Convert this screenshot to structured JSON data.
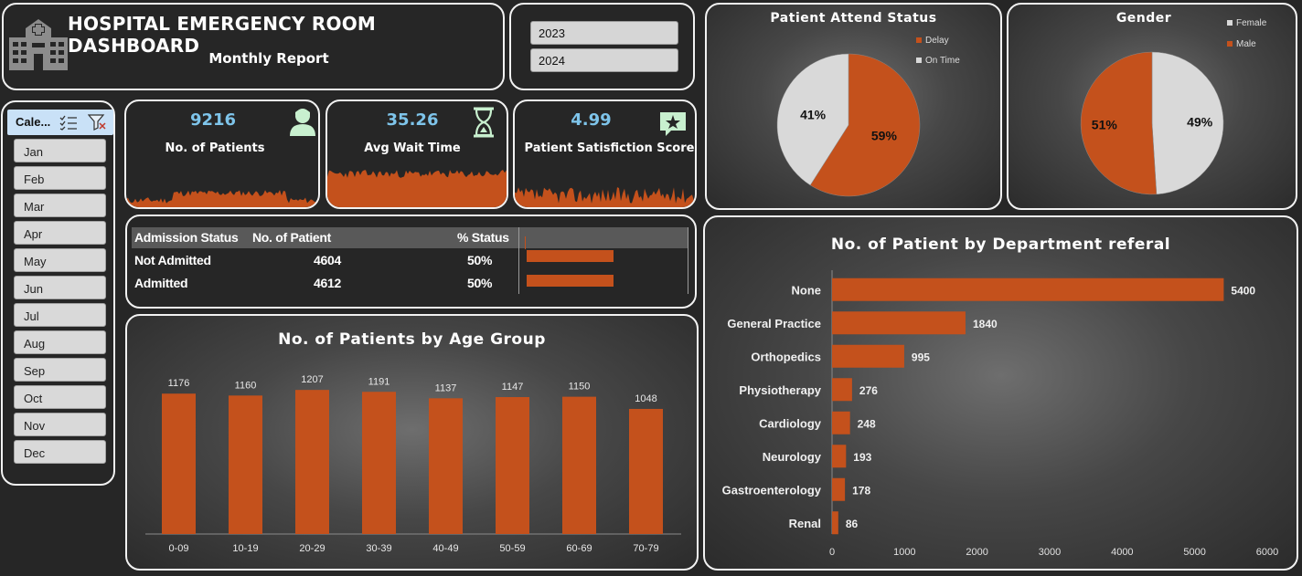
{
  "header": {
    "title": "HOSPITAL EMERGENCY ROOM DASHBOARD",
    "subtitle": "Monthly Report",
    "icon": "hospital-icon"
  },
  "year_slicer": {
    "options": [
      "2023",
      "2024"
    ]
  },
  "month_slicer": {
    "title": "Cale...",
    "multi_select_icon": "multi-select-icon",
    "clear_filter_icon": "clear-filter-icon",
    "months": [
      "Jan",
      "Feb",
      "Mar",
      "Apr",
      "May",
      "Jun",
      "Jul",
      "Aug",
      "Sep",
      "Oct",
      "Nov",
      "Dec"
    ]
  },
  "kpis": [
    {
      "value": "9216",
      "label": "No. of Patients",
      "icon": "patient-icon"
    },
    {
      "value": "35.26",
      "label": "Avg Wait Time",
      "icon": "hourglass-icon"
    },
    {
      "value": "4.99",
      "label": "Patient Satisfiction Score",
      "icon": "star-review-icon"
    }
  ],
  "admission": {
    "headers": [
      "Admission Status",
      "No. of Patient",
      "% Status"
    ],
    "rows": [
      {
        "status": "Not Admitted",
        "count": "4604",
        "pct": "50%",
        "share": 0.4996
      },
      {
        "status": "Admitted",
        "count": "4612",
        "pct": "50%",
        "share": 0.5004
      }
    ]
  },
  "attend_status": {
    "title": "Patient Attend Status",
    "legend": [
      "Delay",
      "On Time"
    ],
    "colors": {
      "Delay": "#c4511c",
      "On Time": "#d9d9d9"
    }
  },
  "gender": {
    "title": "Gender",
    "legend": [
      "Female",
      "Male"
    ],
    "colors": {
      "Female": "#d9d9d9",
      "Male": "#c4511c"
    }
  },
  "age_chart": {
    "title": "No. of Patients by Age Group"
  },
  "dept_chart": {
    "title": "No. of Patient by Department referal"
  },
  "colors": {
    "accent": "#c4511c",
    "kpi_value": "#7ec4ea",
    "background": "#262626"
  },
  "chart_data": [
    {
      "type": "pie",
      "title": "Patient Attend Status",
      "labels": [
        "Delay",
        "On Time"
      ],
      "values": [
        59,
        41
      ],
      "value_labels": [
        "59%",
        "41%"
      ],
      "legend": "top-right"
    },
    {
      "type": "pie",
      "title": "Gender",
      "labels": [
        "Female",
        "Male"
      ],
      "values": [
        49,
        51
      ],
      "value_labels": [
        "49%",
        "51%"
      ],
      "legend": "top-right"
    },
    {
      "type": "bar",
      "title": "No. of Patients by Age Group",
      "categories": [
        "0-09",
        "10-19",
        "20-29",
        "30-39",
        "40-49",
        "50-59",
        "60-69",
        "70-79"
      ],
      "values": [
        1176,
        1160,
        1207,
        1191,
        1137,
        1147,
        1150,
        1048
      ],
      "ylim": [
        0,
        1300
      ],
      "grid": false
    },
    {
      "type": "bar",
      "orientation": "horizontal",
      "title": "No. of Patient by Department referal",
      "categories": [
        "None",
        "General Practice",
        "Orthopedics",
        "Physiotherapy",
        "Cardiology",
        "Neurology",
        "Gastroenterology",
        "Renal"
      ],
      "values": [
        5400,
        1840,
        995,
        276,
        248,
        193,
        178,
        86
      ],
      "xlim": [
        0,
        6000
      ],
      "xticks": [
        "0",
        "1000",
        "2000",
        "3000",
        "4000",
        "5000",
        "6000"
      ],
      "grid": false
    }
  ]
}
